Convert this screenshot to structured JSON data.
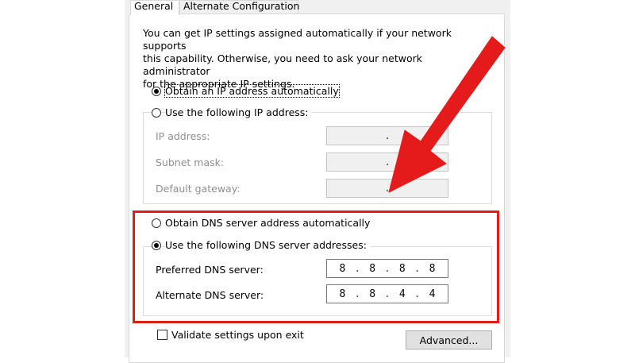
{
  "tabs": [
    {
      "label": "General"
    },
    {
      "label": "Alternate Configuration"
    }
  ],
  "description": "You can get IP settings assigned automatically if your network supports\nthis capability. Otherwise, you need to ask your network administrator\nfor the appropriate IP settings.",
  "ip": {
    "auto_label": "Obtain an IP address automatically",
    "manual_label": "Use the following IP address:",
    "fields": [
      {
        "label": "IP address:",
        "value": "."
      },
      {
        "label": "Subnet mask:",
        "value": "."
      },
      {
        "label": "Default gateway:",
        "value": "."
      }
    ]
  },
  "dns": {
    "auto_label": "Obtain DNS server address automatically",
    "manual_label": "Use the following DNS server addresses:",
    "preferred": {
      "label": "Preferred DNS server:",
      "octets": [
        "8",
        "8",
        "8",
        "8"
      ]
    },
    "alternate": {
      "label": "Alternate DNS server:",
      "octets": [
        "8",
        "8",
        "4",
        "4"
      ]
    }
  },
  "validate_label": "Validate settings upon exit",
  "advanced_label": "Advanced...",
  "colors": {
    "annotation_red": "#e51a1a",
    "dialog_bg": "#f0f0f0"
  },
  "icons": {
    "annotation": "red-arrow-icon"
  }
}
